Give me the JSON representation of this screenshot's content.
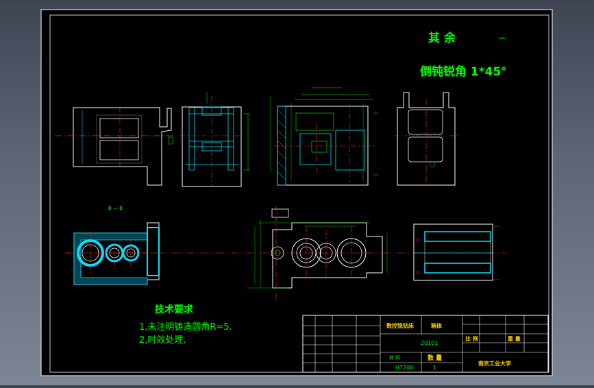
{
  "drawing": {
    "roughness": {
      "label": "其 余",
      "symbol": "∽"
    },
    "chamfer_note": "倒钝锐角 1*45°",
    "section_label": "B — B",
    "tech_req": {
      "title": "技术要求",
      "item1": "1,未注明铸造圆角R=5.",
      "item2": "2,时效处理."
    },
    "title_block": {
      "machine": "数控铣钻床",
      "part": "箱体",
      "drawing_no": "20101",
      "scale_label": "比 例",
      "weight_label": "重 量",
      "material_label": "材 料",
      "quantity_label": "数 量",
      "material": "HT200",
      "quantity": "1",
      "school": "南京工业大学"
    }
  },
  "colors": {
    "background": "#000000",
    "line": "#ffffff",
    "center": "#ff3030",
    "dim": "#00ff00",
    "hatch": "#00e5ff",
    "frame_blue": "#3a5cff",
    "text": "#00ff00",
    "label_yellow": "#ffd700"
  }
}
